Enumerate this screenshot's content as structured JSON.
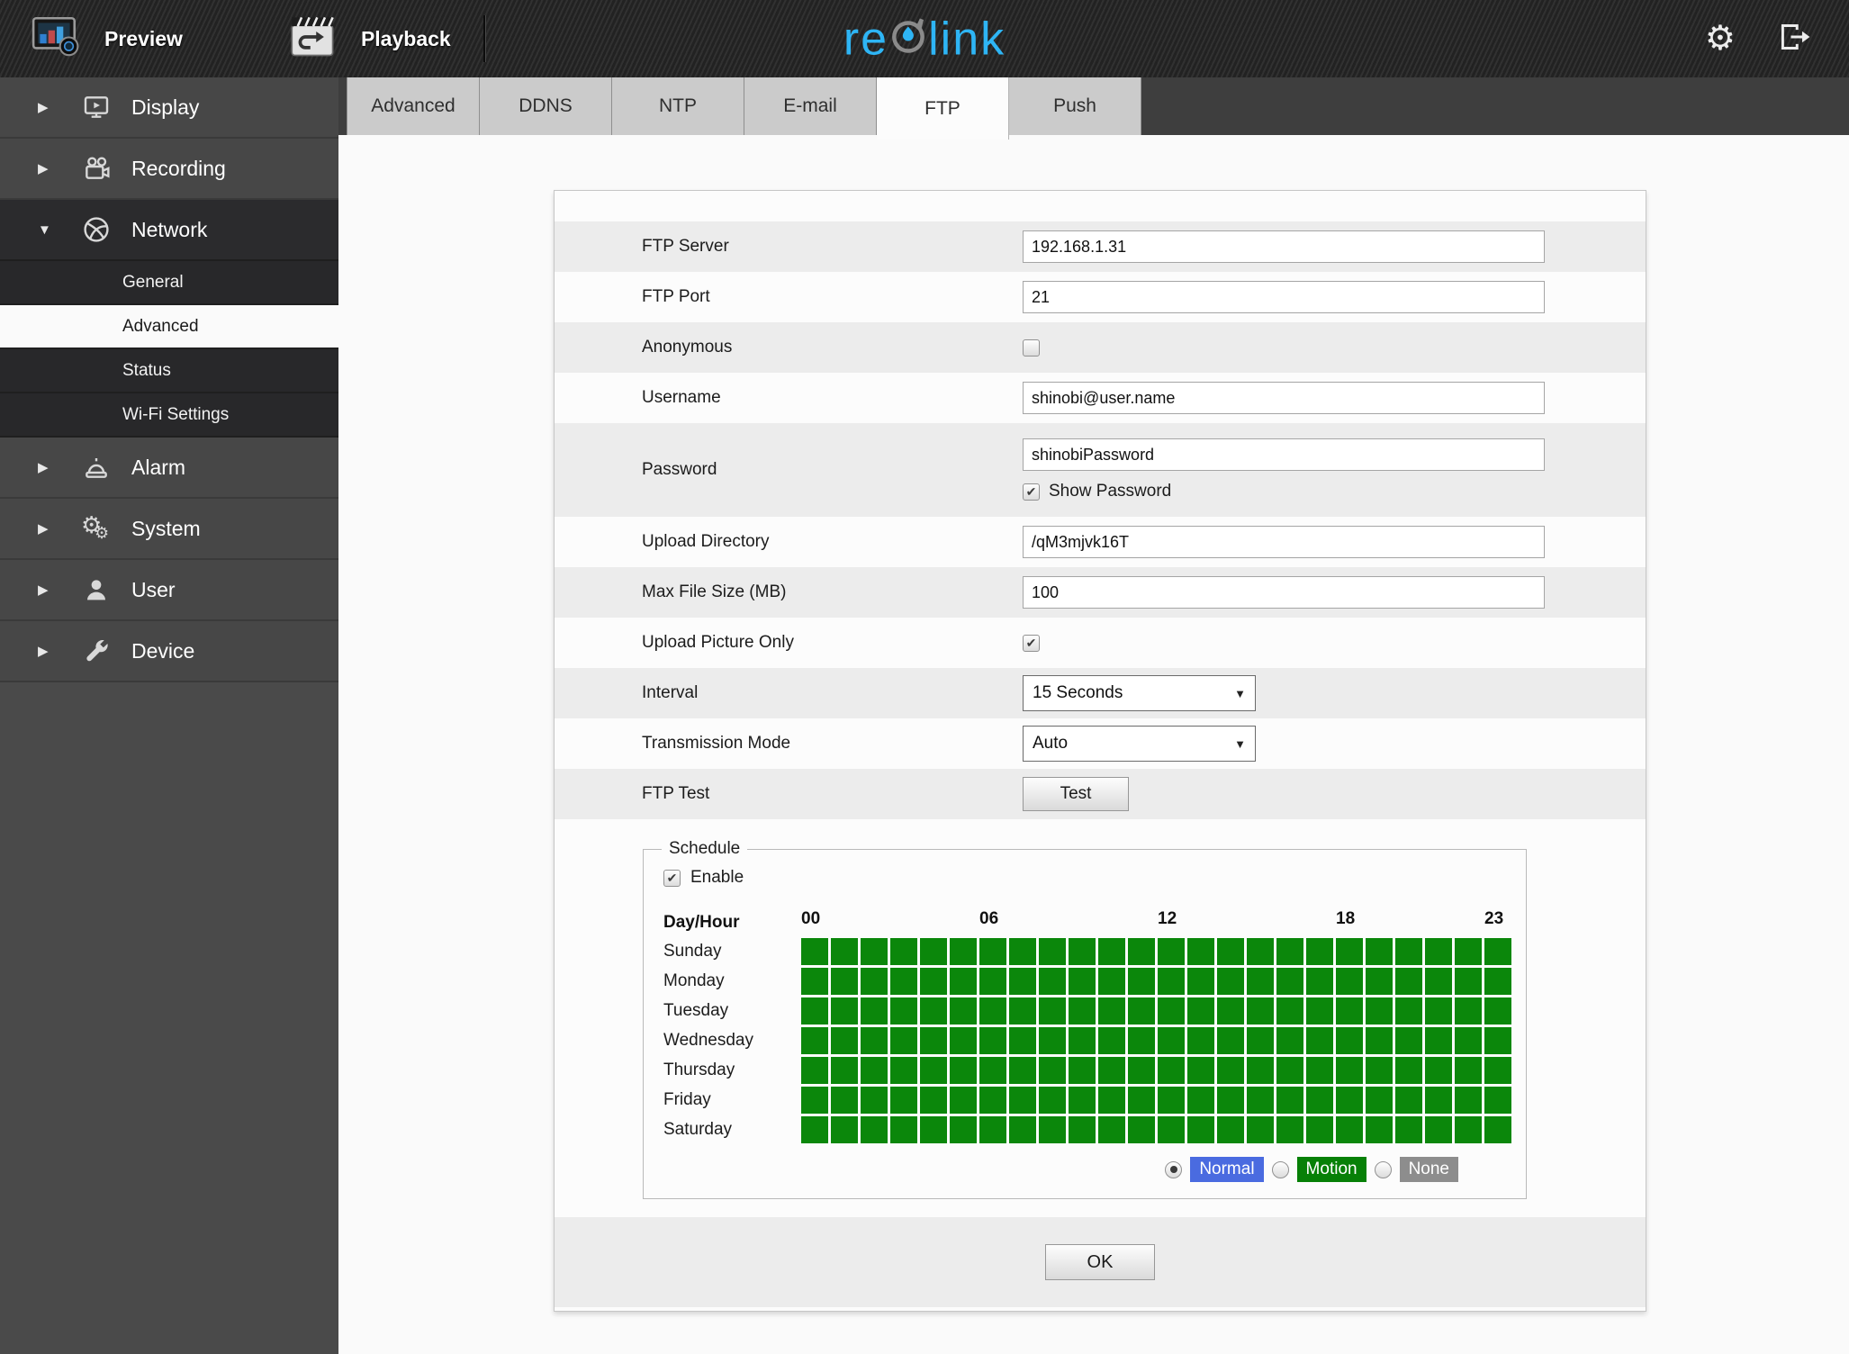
{
  "topbar": {
    "preview_label": "Preview",
    "playback_label": "Playback",
    "brand": {
      "prefix": "re",
      "suffix": "link",
      "color": "#2eb5f5"
    },
    "right_icons": [
      "gear-icon",
      "logout-icon"
    ]
  },
  "tabs": {
    "items": [
      "Advanced",
      "DDNS",
      "NTP",
      "E-mail",
      "FTP",
      "Push"
    ],
    "active": "FTP"
  },
  "sidebar": {
    "items": [
      {
        "label": "Display",
        "icon": "display-icon",
        "state": "collapsed"
      },
      {
        "label": "Recording",
        "icon": "recording-icon",
        "state": "collapsed"
      },
      {
        "label": "Network",
        "icon": "network-icon",
        "state": "expanded",
        "children": [
          {
            "label": "General",
            "selected": false
          },
          {
            "label": "Advanced",
            "selected": true
          },
          {
            "label": "Status",
            "selected": false
          },
          {
            "label": "Wi-Fi Settings",
            "selected": false
          }
        ]
      },
      {
        "label": "Alarm",
        "icon": "alarm-icon",
        "state": "collapsed"
      },
      {
        "label": "System",
        "icon": "system-icon",
        "state": "collapsed"
      },
      {
        "label": "User",
        "icon": "user-icon",
        "state": "collapsed"
      },
      {
        "label": "Device",
        "icon": "device-icon",
        "state": "collapsed"
      }
    ]
  },
  "form": {
    "rows": [
      {
        "id": "ftp-server",
        "label": "FTP Server",
        "type": "text",
        "value": "192.168.1.31"
      },
      {
        "id": "ftp-port",
        "label": "FTP Port",
        "type": "text",
        "value": "21"
      },
      {
        "id": "anonymous",
        "label": "Anonymous",
        "type": "checkbox",
        "checked": false
      },
      {
        "id": "username",
        "label": "Username",
        "type": "text",
        "value": "shinobi@user.name"
      },
      {
        "id": "password",
        "label": "Password",
        "type": "text",
        "value": "shinobiPassword",
        "sub_checkbox": {
          "label": "Show Password",
          "checked": true
        }
      },
      {
        "id": "upload-directory",
        "label": "Upload Directory",
        "type": "text",
        "value": "/qM3mjvk16T"
      },
      {
        "id": "max-file-size",
        "label": "Max File Size (MB)",
        "type": "text",
        "value": "100"
      },
      {
        "id": "upload-picture-only",
        "label": "Upload Picture Only",
        "type": "checkbox",
        "checked": true
      },
      {
        "id": "interval",
        "label": "Interval",
        "type": "select",
        "value": "15 Seconds"
      },
      {
        "id": "transmission-mode",
        "label": "Transmission Mode",
        "type": "select",
        "value": "Auto"
      },
      {
        "id": "ftp-test",
        "label": "FTP Test",
        "type": "button",
        "value": "Test"
      }
    ]
  },
  "schedule": {
    "legend": "Schedule",
    "enable": {
      "label": "Enable",
      "checked": true
    },
    "corner_label": "Day/Hour",
    "hour_ticks": [
      {
        "label": "00",
        "col": 0
      },
      {
        "label": "06",
        "col": 6
      },
      {
        "label": "12",
        "col": 12
      },
      {
        "label": "18",
        "col": 18
      },
      {
        "label": "23",
        "col": 23
      }
    ],
    "hours_per_day": 24,
    "days": [
      "Sunday",
      "Monday",
      "Tuesday",
      "Wednesday",
      "Thursday",
      "Friday",
      "Saturday"
    ],
    "grid_state": "all cells active (green / motion) for every hour of every day",
    "cell_color": "#0b870b",
    "modes": [
      {
        "label": "Normal",
        "color": "#4a6be0",
        "selected": true
      },
      {
        "label": "Motion",
        "color": "#078007",
        "selected": false
      },
      {
        "label": "None",
        "color": "#8d8d8d",
        "selected": false
      }
    ]
  },
  "footer": {
    "ok_label": "OK"
  }
}
